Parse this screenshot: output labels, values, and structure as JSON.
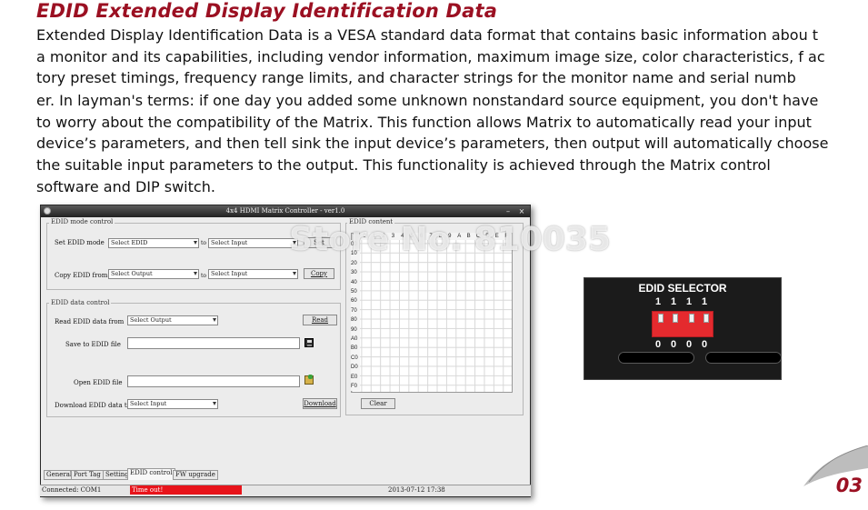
{
  "heading": "EDID Extended Display Identification Data",
  "paragraph_line1": "Extended Display Identification Data is a VESA standard data format that contains basic information abou t a monitor and its capabilities, including vendor information, maximum image size, color characteristics, f actory preset timings, frequency range limits, and character strings for the monitor name and serial numb",
  "paragraph_line2": "er. In layman's terms: if one day you added some unknown nonstandard source equipment, you don't have to worry about the compatibility of the Matrix. This function allows Matrix to automatically read your input device’s parameters, and then tell sink the input device’s parameters, then output will automatically choose the suitable input parameters to the output. This functionality is achieved through the Matrix control software and DIP switch.",
  "watermark": "Store No. 810035",
  "window": {
    "title": "4x4 HDMI Matrix Controller - ver1.0",
    "minimize": "–",
    "close": "×"
  },
  "edid_mode": {
    "group_label": "EDID mode control",
    "set_label": "Set EDID mode",
    "set_select": "Select EDID",
    "to1": "to",
    "set_target": "Select Input",
    "set_button": "Set",
    "copy_label": "Copy EDID from",
    "copy_select": "Select Output",
    "to2": "to",
    "copy_target": "Select Input",
    "copy_button": "Copy"
  },
  "edid_data": {
    "group_label": "EDID data control",
    "read_label": "Read EDID data from",
    "read_select": "Select Output",
    "read_button": "Read",
    "save_label": "Save to EDID file",
    "save_value": "",
    "open_label": "Open EDID file",
    "open_value": "",
    "download_label": "Download EDID data to",
    "download_select": "Select Input",
    "download_button": "Download"
  },
  "edid_content": {
    "group_label": "EDID content",
    "columns": [
      "0",
      "1",
      "2",
      "3",
      "4",
      "5",
      "6",
      "7",
      "8",
      "9",
      "A",
      "B",
      "C",
      "D",
      "E",
      "F"
    ],
    "rows": [
      "00",
      "10",
      "20",
      "30",
      "40",
      "50",
      "60",
      "70",
      "80",
      "90",
      "A0",
      "B0",
      "C0",
      "D0",
      "E0",
      "F0"
    ],
    "clear_button": "Clear"
  },
  "tabs": [
    "General",
    "Port Tag",
    "Setting",
    "EDID control",
    "FW upgrade"
  ],
  "active_tab": "EDID control",
  "status": {
    "connection": "Connected: COM1",
    "message": "Time out!",
    "datetime": "2013-07-12 17:38"
  },
  "device": {
    "label": "EDID SELECTOR",
    "top_labels": [
      "1",
      "1",
      "1",
      "1"
    ],
    "bottom_labels": [
      "0",
      "0",
      "0",
      "0"
    ],
    "switch_positions": [
      "up",
      "up",
      "up",
      "up"
    ]
  },
  "page_number": "03",
  "colors": {
    "heading": "#9b1022",
    "status_error": "#e8141b",
    "dip_switch": "#e42a2e"
  }
}
